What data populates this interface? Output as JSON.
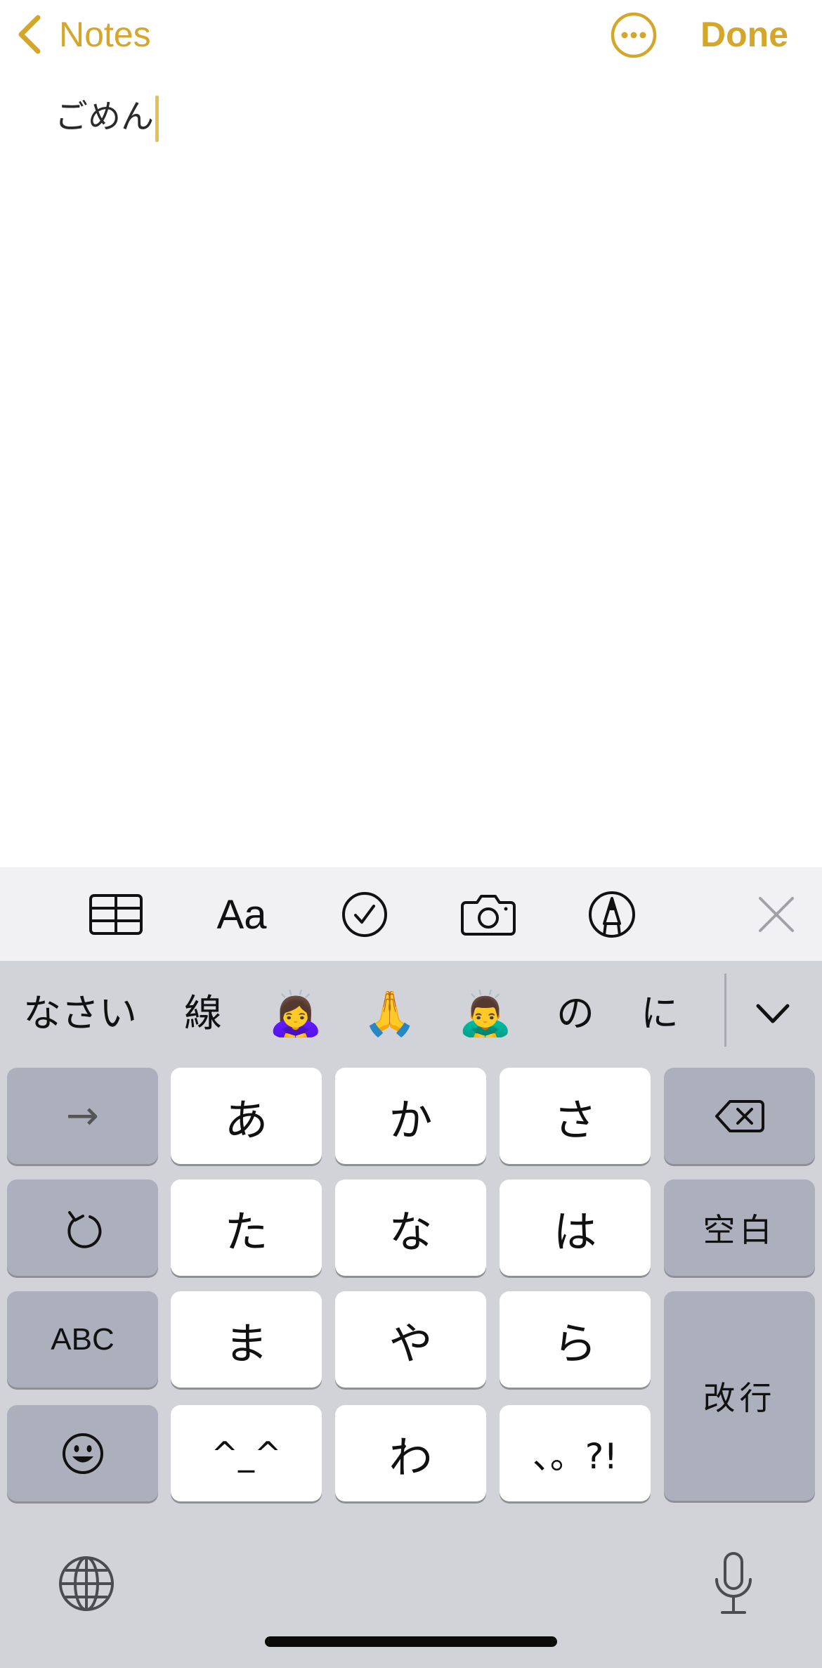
{
  "header": {
    "back_label": "Notes",
    "done_label": "Done",
    "back_icon": "chevron-left-icon",
    "more_icon": "ellipsis-circle-icon",
    "accent_color": "#D4A72C"
  },
  "note": {
    "text": "ごめん"
  },
  "toolbar": {
    "items": [
      "table-icon",
      "Aa",
      "checklist-icon",
      "camera-icon",
      "markup-pen-icon",
      "close-icon"
    ],
    "format_label": "Aa"
  },
  "candidates": {
    "items": [
      "なさい",
      "線",
      "🙇‍♀️",
      "🙏",
      "🙇‍♂️",
      "の",
      "に"
    ],
    "expand_icon": "chevron-down-icon"
  },
  "keyboard": {
    "keys": {
      "a": "あ",
      "ka": "か",
      "sa": "さ",
      "ta": "た",
      "na": "な",
      "ha": "は",
      "ma": "ま",
      "ya": "や",
      "ra": "ら",
      "kaomoji": "^_^",
      "wa": "わ",
      "punct": "、。?!"
    },
    "fn": {
      "next": "→",
      "abc": "ABC",
      "space": "空白",
      "return": "改行"
    },
    "icons": [
      "undo-icon",
      "delete-icon",
      "emoji-icon",
      "globe-icon",
      "microphone-icon"
    ]
  }
}
